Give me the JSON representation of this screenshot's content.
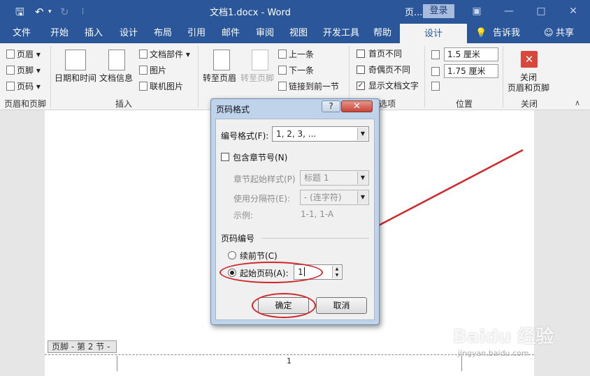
{
  "titlebar": {
    "title": "文档1.docx  -  Word",
    "context_tab": "页...",
    "login": "登录"
  },
  "tabs": [
    "文件",
    "开始",
    "插入",
    "设计",
    "布局",
    "引用",
    "邮件",
    "审阅",
    "视图",
    "开发工具",
    "帮助"
  ],
  "active_tab": "设计",
  "tell_me": "告诉我",
  "share": "共享",
  "ribbon": {
    "hf": {
      "header": "页眉",
      "footer": "页脚",
      "page_number": "页码",
      "group": "页眉和页脚"
    },
    "insert": {
      "datetime": "日期和时间",
      "docinfo": "文档信息",
      "quickparts": "文档部件",
      "picture": "图片",
      "online_picture": "联机图片",
      "group": "插入"
    },
    "nav": {
      "goto_header": "转至页眉",
      "goto_footer": "转至页脚",
      "previous": "上一条",
      "next": "下一条",
      "link_previous": "链接到前一节"
    },
    "options": {
      "diff_first": "首页不同",
      "diff_odd_even": "奇偶页不同",
      "show_text": "显示文档文字",
      "group": "选项"
    },
    "position": {
      "top_value": "1.5 厘米",
      "bottom_value": "1.75 厘米",
      "group": "位置"
    },
    "close": {
      "label": "关闭\n页眉和页脚",
      "label1": "关闭",
      "label2": "页眉和页脚",
      "group": "关闭"
    }
  },
  "dialog": {
    "title": "页码格式",
    "help": "?",
    "format_label": "编号格式(F):",
    "format_value": "1, 2, 3, ...",
    "include_chapter": "包含章节号(N)",
    "chapter_style_label": "章节起始样式(P)",
    "chapter_style_value": "标题 1",
    "separator_label": "使用分隔符(E):",
    "separator_value": "-  (连字符)",
    "example_label": "示例:",
    "example_value": "1-1, 1-A",
    "numbering_group": "页码编号",
    "continue_label": "续前节(C)",
    "start_at_label": "起始页码(A):",
    "start_at_value": "1",
    "ok": "确定",
    "cancel": "取消"
  },
  "document": {
    "footer_tag": "页脚 - 第 2 节 -",
    "page_number": "1"
  },
  "watermark": {
    "text": "Baidu 经验",
    "sub": "jingyan.baidu.com"
  },
  "colors": {
    "accent": "#2b579a",
    "annotation": "#d0272b"
  }
}
